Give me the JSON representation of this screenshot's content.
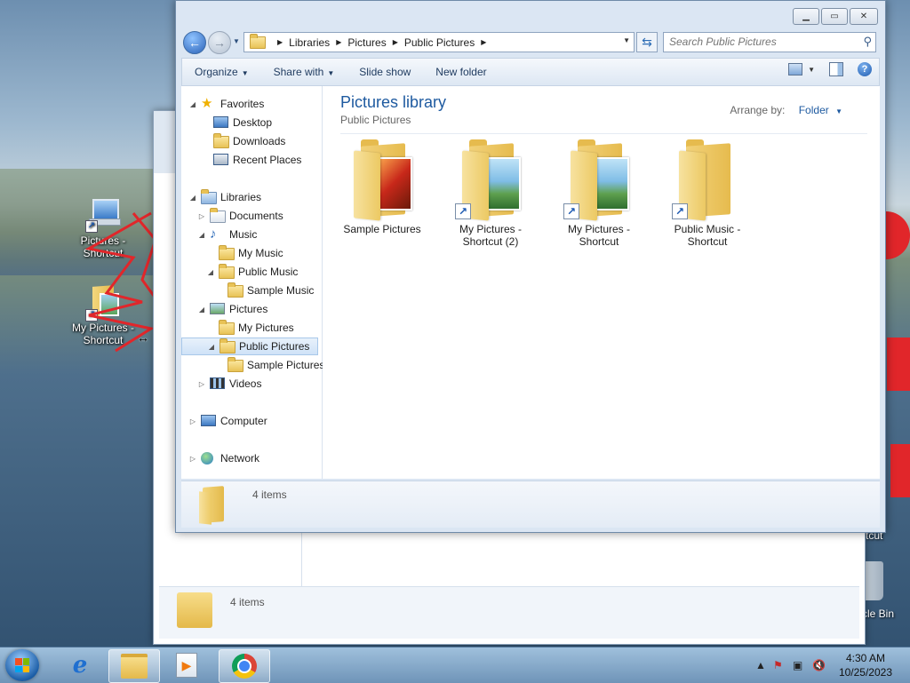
{
  "desktop": {
    "icons": [
      {
        "label": "Pictures - Shortcut"
      },
      {
        "label": "My Pictures - Shortcut"
      }
    ],
    "partial_labels": [
      "rtcut",
      "cle Bin"
    ]
  },
  "background_window": {
    "status_text": "4 items"
  },
  "explorer": {
    "breadcrumb": [
      "Libraries",
      "Pictures",
      "Public Pictures"
    ],
    "search_placeholder": "Search Public Pictures",
    "commands": {
      "organize": "Organize",
      "share_with": "Share with",
      "slide_show": "Slide show",
      "new_folder": "New folder"
    },
    "nav": {
      "favorites": "Favorites",
      "desktop": "Desktop",
      "downloads": "Downloads",
      "recent_places": "Recent Places",
      "libraries": "Libraries",
      "documents": "Documents",
      "music": "Music",
      "my_music": "My Music",
      "public_music": "Public Music",
      "sample_music": "Sample Music",
      "pictures": "Pictures",
      "my_pictures": "My Pictures",
      "public_pictures": "Public Pictures",
      "sample_pictures": "Sample Pictures",
      "videos": "Videos",
      "computer": "Computer",
      "network": "Network"
    },
    "content": {
      "title": "Pictures library",
      "subtitle": "Public Pictures",
      "arrange_label": "Arrange by:",
      "arrange_value": "Folder",
      "items": [
        {
          "label": "Sample Pictures",
          "shortcut": false
        },
        {
          "label": "My Pictures - Shortcut (2)",
          "shortcut": true
        },
        {
          "label": "My Pictures - Shortcut",
          "shortcut": true
        },
        {
          "label": "Public Music - Shortcut",
          "shortcut": true
        }
      ]
    },
    "details": {
      "count": "4 items"
    }
  },
  "taskbar": {
    "time": "4:30 AM",
    "date": "10/25/2023"
  },
  "colors": {
    "accent_blue": "#1e5aa0",
    "desktop_red": "#e1262a",
    "folder_yellow": "#e6bb4e"
  }
}
